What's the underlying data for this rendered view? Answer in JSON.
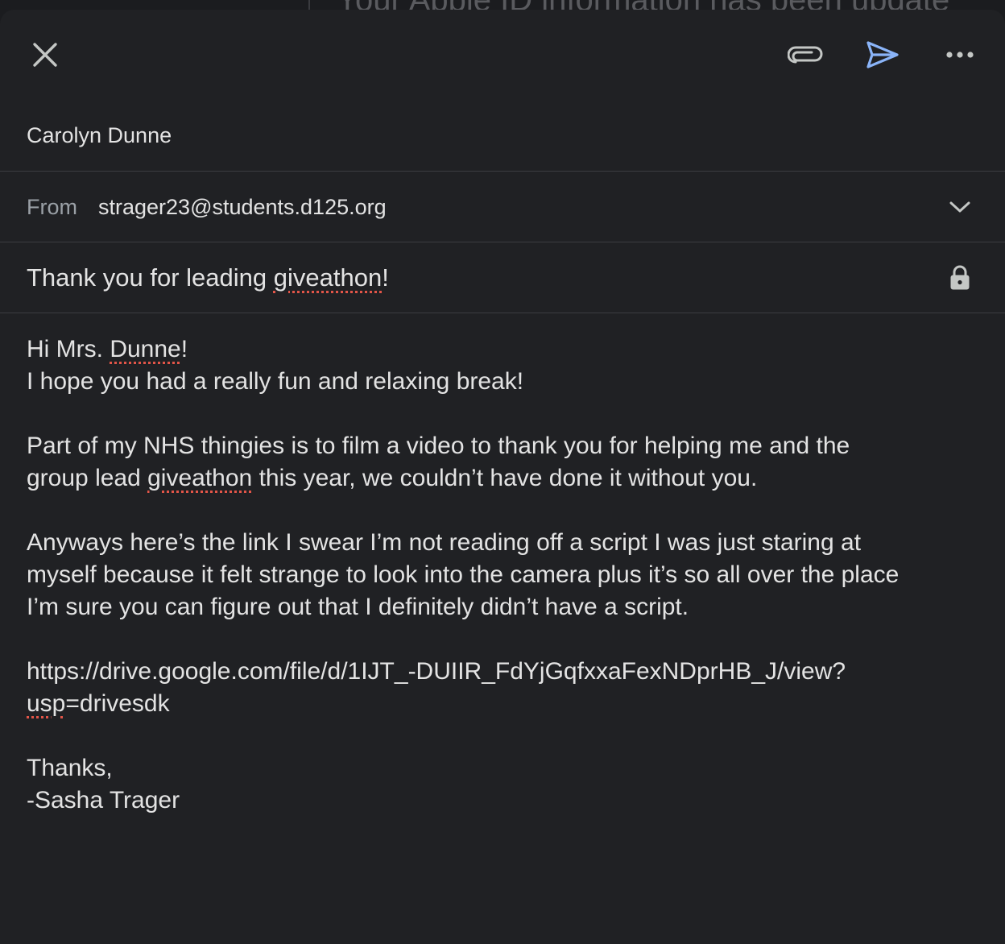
{
  "backdrop": {
    "title_fragment": "Your Apple ID information has been update"
  },
  "toolbar": {
    "close_icon": "close-icon",
    "attach_icon": "paperclip-icon",
    "send_icon": "send-icon",
    "more_icon": "more-horizontal-icon",
    "send_color": "#8ab4f8"
  },
  "compose": {
    "to": "Carolyn Dunne",
    "from_label": "From",
    "from_value": "strager23@students.d125.org",
    "subject_before": "Thank you for leading ",
    "subject_misspelled": "giveathon",
    "subject_after": "!",
    "body": {
      "line1_before": "Hi Mrs. ",
      "line1_misspelled": "Dunne",
      "line1_after": "!",
      "line2": "I hope you had a really fun and relaxing break!",
      "para2_line1": "Part of my NHS thingies is to film a video to thank you for helping me and the",
      "para2_line2_before": "group lead ",
      "para2_line2_misspelled": "giveathon",
      "para2_line2_after": " this year, we couldn’t have done it without you.",
      "para3_line1": "Anyways here’s the link I swear I’m not reading off a script I was just staring at",
      "para3_line2": "myself because it felt strange to look into the camera plus it’s so all over the place",
      "para3_line3": "I’m sure you can figure out that I definitely didn’t have a script.",
      "link_line1": "https://drive.google.com/file/d/1IJT_-DUIIR_FdYjGqfxxaFexNDprHB_J/view?",
      "link_line2_misspelled": "usp",
      "link_line2_after": "=drivesdk",
      "signoff": "Thanks,",
      "signature": "-Sasha Trager"
    }
  }
}
